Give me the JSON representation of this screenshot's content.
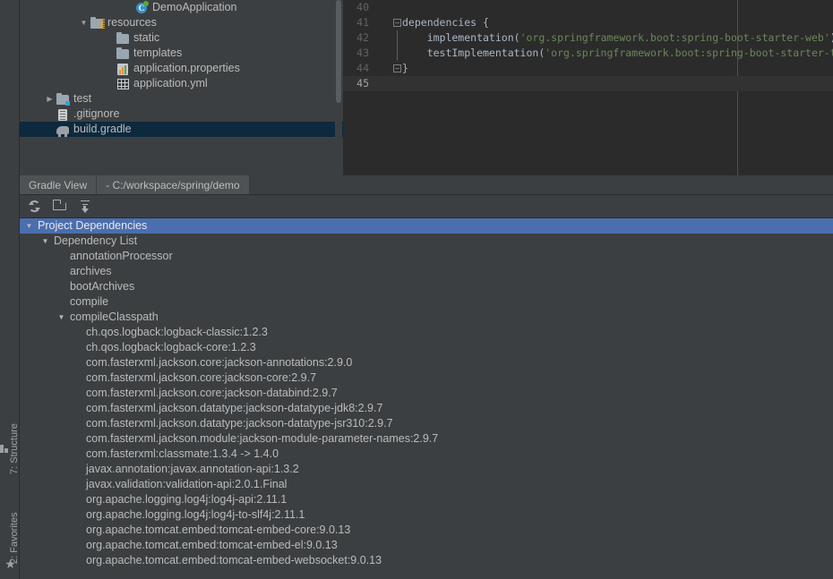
{
  "project_tree": {
    "rows": [
      {
        "label": "DemoApplication",
        "icon": "java-class-icon",
        "indent": 128,
        "arrow": "",
        "selected": false,
        "icon_text": "C"
      },
      {
        "label": "resources",
        "icon": "resources-folder-icon",
        "indent": 78,
        "arrow": "▼",
        "selected": false
      },
      {
        "label": "static",
        "icon": "folder-icon",
        "indent": 107,
        "arrow": "",
        "selected": false
      },
      {
        "label": "templates",
        "icon": "folder-icon",
        "indent": 107,
        "arrow": "",
        "selected": false
      },
      {
        "label": "application.properties",
        "icon": "properties-file-icon",
        "indent": 107,
        "arrow": "",
        "selected": false
      },
      {
        "label": "application.yml",
        "icon": "yaml-file-icon",
        "indent": 107,
        "arrow": "",
        "selected": false
      },
      {
        "label": "test",
        "icon": "test-folder-icon",
        "indent": 40,
        "arrow": "▶",
        "selected": false
      },
      {
        "label": ".gitignore",
        "icon": "gitignore-file-icon",
        "indent": 40,
        "arrow": "",
        "selected": false
      },
      {
        "label": "build.gradle",
        "icon": "gradle-file-icon",
        "indent": 40,
        "arrow": "",
        "selected": true
      }
    ]
  },
  "editor": {
    "lines": [
      {
        "number": "40",
        "code": "",
        "fold": "",
        "current": false
      },
      {
        "number": "41",
        "code": "dependencies {",
        "fold": "minus",
        "current": false
      },
      {
        "number": "42",
        "code": "    implementation(",
        "string": "'org.springframework.boot:spring-boot-starter-web'",
        "after": ")",
        "fold": "bar",
        "current": false
      },
      {
        "number": "43",
        "code": "    testImplementation(",
        "string": "'org.springframework.boot:spring-boot-starter-test'",
        "after": ")",
        "fold": "bar",
        "current": false
      },
      {
        "number": "44",
        "code": "}",
        "fold": "end",
        "current": false
      },
      {
        "number": "45",
        "code": "",
        "fold": "",
        "current": true
      }
    ]
  },
  "gradle_window": {
    "tab_label": "Gradle View",
    "path_label": "- C:/workspace/spring/demo",
    "toolbar": {
      "refresh_title": "Refresh",
      "open_title": "Open Gradle Config",
      "collapse_title": "Collapse All"
    },
    "tree": [
      {
        "label": "Project Dependencies",
        "depth": 0,
        "arrow": "▼",
        "selected": true
      },
      {
        "label": "Dependency List",
        "depth": 1,
        "arrow": "▼",
        "selected": false
      },
      {
        "label": "annotationProcessor",
        "depth": 2,
        "arrow": "",
        "selected": false
      },
      {
        "label": "archives",
        "depth": 2,
        "arrow": "",
        "selected": false
      },
      {
        "label": "bootArchives",
        "depth": 2,
        "arrow": "",
        "selected": false
      },
      {
        "label": "compile",
        "depth": 2,
        "arrow": "",
        "selected": false
      },
      {
        "label": "compileClasspath",
        "depth": 2,
        "arrow": "▼",
        "selected": false
      },
      {
        "label": "ch.qos.logback:logback-classic:1.2.3",
        "depth": 3,
        "arrow": "",
        "selected": false
      },
      {
        "label": "ch.qos.logback:logback-core:1.2.3",
        "depth": 3,
        "arrow": "",
        "selected": false
      },
      {
        "label": "com.fasterxml.jackson.core:jackson-annotations:2.9.0",
        "depth": 3,
        "arrow": "",
        "selected": false
      },
      {
        "label": "com.fasterxml.jackson.core:jackson-core:2.9.7",
        "depth": 3,
        "arrow": "",
        "selected": false
      },
      {
        "label": "com.fasterxml.jackson.core:jackson-databind:2.9.7",
        "depth": 3,
        "arrow": "",
        "selected": false
      },
      {
        "label": "com.fasterxml.jackson.datatype:jackson-datatype-jdk8:2.9.7",
        "depth": 3,
        "arrow": "",
        "selected": false
      },
      {
        "label": "com.fasterxml.jackson.datatype:jackson-datatype-jsr310:2.9.7",
        "depth": 3,
        "arrow": "",
        "selected": false
      },
      {
        "label": "com.fasterxml.jackson.module:jackson-module-parameter-names:2.9.7",
        "depth": 3,
        "arrow": "",
        "selected": false
      },
      {
        "label": "com.fasterxml:classmate:1.3.4 ->  1.4.0",
        "depth": 3,
        "arrow": "",
        "selected": false
      },
      {
        "label": "javax.annotation:javax.annotation-api:1.3.2",
        "depth": 3,
        "arrow": "",
        "selected": false
      },
      {
        "label": "javax.validation:validation-api:2.0.1.Final",
        "depth": 3,
        "arrow": "",
        "selected": false
      },
      {
        "label": "org.apache.logging.log4j:log4j-api:2.11.1",
        "depth": 3,
        "arrow": "",
        "selected": false
      },
      {
        "label": "org.apache.logging.log4j:log4j-to-slf4j:2.11.1",
        "depth": 3,
        "arrow": "",
        "selected": false
      },
      {
        "label": "org.apache.tomcat.embed:tomcat-embed-core:9.0.13",
        "depth": 3,
        "arrow": "",
        "selected": false
      },
      {
        "label": "org.apache.tomcat.embed:tomcat-embed-el:9.0.13",
        "depth": 3,
        "arrow": "",
        "selected": false
      },
      {
        "label": "org.apache.tomcat.embed:tomcat-embed-websocket:9.0.13",
        "depth": 3,
        "arrow": "",
        "selected": false
      }
    ]
  },
  "tool_strip": {
    "structure_label": "7: Structure",
    "favorites_label": "2: Favorites"
  },
  "colors": {
    "panel_bg": "#3c3f41",
    "editor_bg": "#2b2b2b",
    "selection_blue": "#4b6eaf",
    "selection_navy": "#0d293e",
    "text": "#bbbbbb",
    "string_green": "#6a8759",
    "code_text": "#a9b7c6"
  }
}
